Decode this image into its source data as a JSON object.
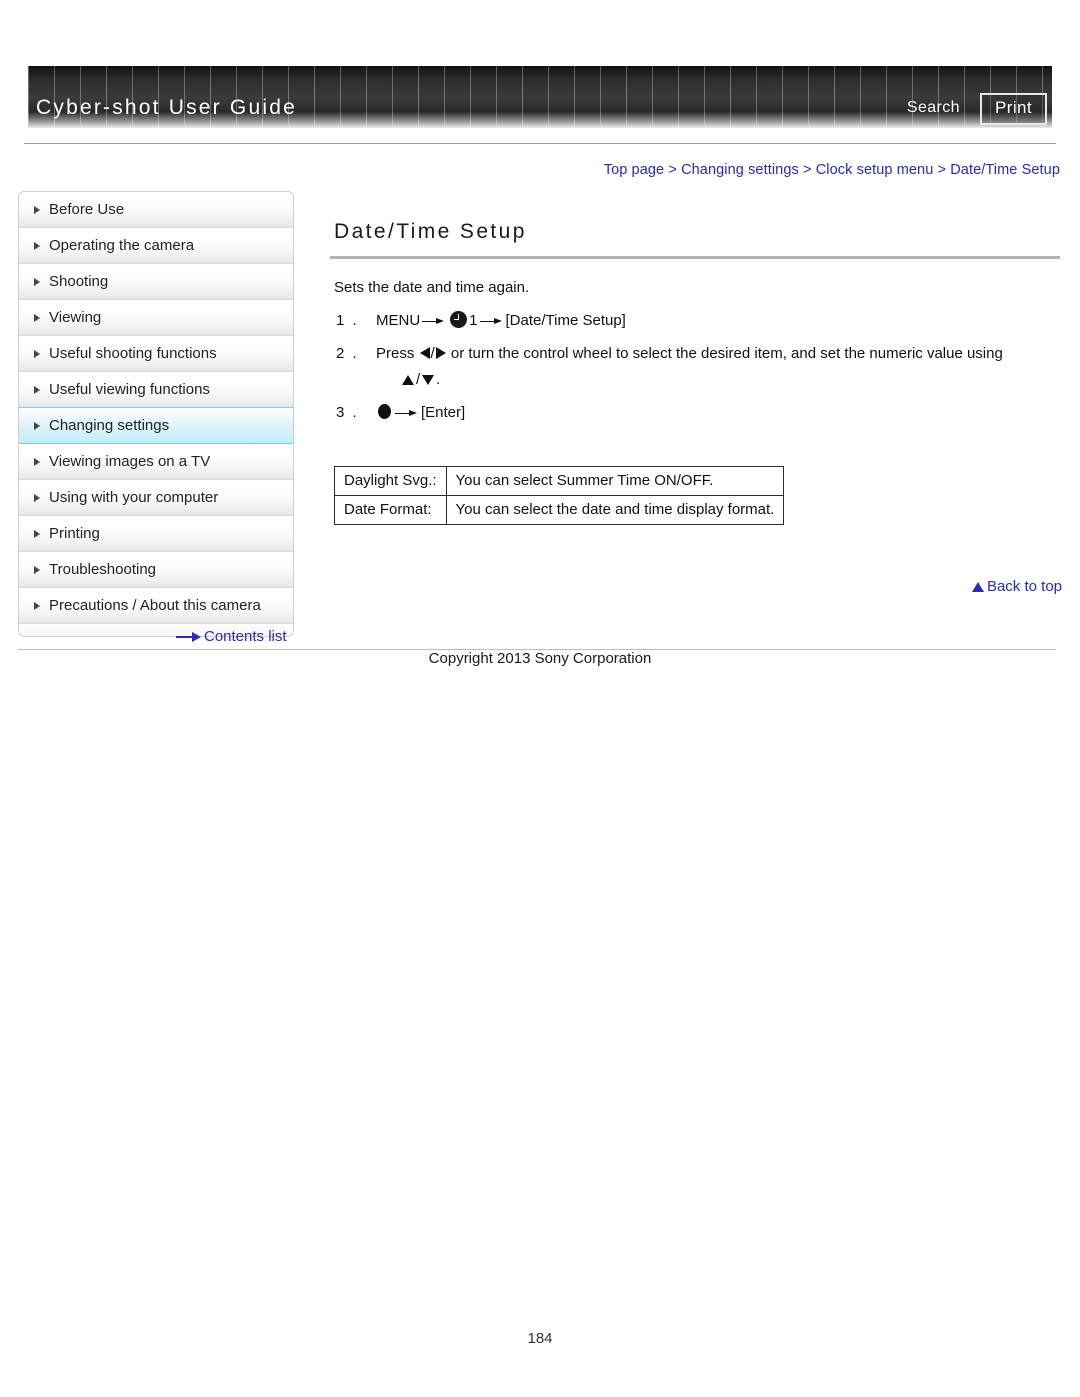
{
  "header": {
    "title": "Cyber-shot User Guide",
    "search_label": "Search",
    "print_label": "Print"
  },
  "breadcrumb": {
    "items": [
      "Top page",
      "Changing settings",
      "Clock setup menu",
      "Date/Time Setup"
    ],
    "separator": ">",
    "color": "#2a2ab4"
  },
  "sidebar": {
    "items": [
      {
        "label": "Before Use",
        "active": false
      },
      {
        "label": "Operating the camera",
        "active": false
      },
      {
        "label": "Shooting",
        "active": false
      },
      {
        "label": "Viewing",
        "active": false
      },
      {
        "label": "Useful shooting functions",
        "active": false
      },
      {
        "label": "Useful viewing functions",
        "active": false
      },
      {
        "label": "Changing settings",
        "active": true
      },
      {
        "label": "Viewing images on a TV",
        "active": false
      },
      {
        "label": "Using with your computer",
        "active": false
      },
      {
        "label": "Printing",
        "active": false
      },
      {
        "label": "Troubleshooting",
        "active": false
      },
      {
        "label": "Precautions / About this camera",
        "active": false
      }
    ],
    "contents_list_label": "Contents list",
    "active_color": "#c8eef7"
  },
  "main": {
    "title": "Date/Time Setup",
    "intro": "Sets the date and time again.",
    "steps": [
      {
        "num": "1 .",
        "part1": "MENU",
        "icon": "clock-icon",
        "part2": "1",
        "part3": "[Date/Time Setup]"
      },
      {
        "num": "2 .",
        "part1": "Press",
        "part2": "/",
        "part3": "or turn the control wheel to select the desired item, and set the numeric value using",
        "part4": "/",
        "part5": "."
      },
      {
        "num": "3 .",
        "part1": "[Enter]"
      }
    ],
    "table": {
      "rows": [
        {
          "key": "Daylight Svg.:",
          "value": "You can select Summer Time ON/OFF."
        },
        {
          "key": "Date Format:",
          "value": "You can select the date and time display format."
        }
      ]
    },
    "back_to_top_label": "Back to top"
  },
  "footer": {
    "copyright": "Copyright 2013 Sony Corporation",
    "page_number": "184"
  }
}
